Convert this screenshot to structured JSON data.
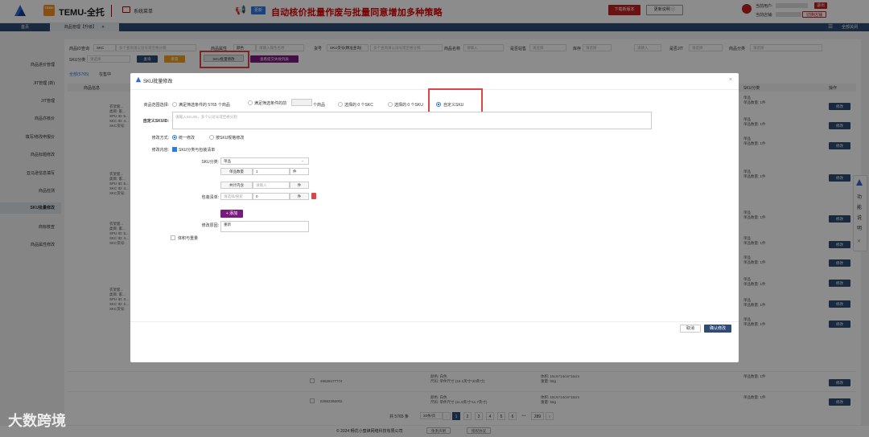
{
  "header": {
    "temu_badge": "TEMU",
    "brand": "TEMU-全托",
    "system_menu": "系统菜单",
    "new_tag": "更新",
    "banner": "自动核价批量作废与批量同意增加多种策略",
    "download_button": "下载新版本",
    "update_button": "更新说明 ⓘ",
    "user_label": "当前用户:",
    "logout": "退出",
    "shop_label": "当前店铺:",
    "switch_shop": "切换店铺"
  },
  "tabs": {
    "home": "首页",
    "product": "商品管理【升级】",
    "close_all": "全部关闭"
  },
  "sidebar": {
    "items": [
      {
        "label": "商品进价管理"
      },
      {
        "label": "JIT管理 (新)"
      },
      {
        "label": "JIT管理"
      },
      {
        "label": "商品亦核价"
      },
      {
        "label": "填写/修改申报价"
      },
      {
        "label": "商品标题修改"
      },
      {
        "label": "亚马逊信息填写"
      },
      {
        "label": "商品检测"
      },
      {
        "label": "SKU批量修改"
      },
      {
        "label": "商标核查"
      },
      {
        "label": "商品属性修改"
      }
    ]
  },
  "filters": {
    "product_id_label": "商品ID查询",
    "product_id_mode": "SKC",
    "product_id_placeholder": "多个查询请以逗号或空格分隔",
    "attr_label": "商品属性",
    "attr_mode": "颜色",
    "attr_placeholder": "请输入属性名称",
    "cargo_label": "货号",
    "cargo_mode": "SKU货号(精准查询)",
    "cargo_placeholder": "多个查询请以逗号或空格分隔",
    "name_label": "商品名称",
    "name_placeholder": "请输入",
    "site_label": "是否站售",
    "site_value": "请选择",
    "stock_label": "库存",
    "stock_value": "请选择",
    "stock_input": "请输入",
    "jit_label": "是否JIT",
    "jit_value": "请选择",
    "category_label": "商品分类",
    "category_value": "请选择",
    "sku_class_label": "SKU分类",
    "sku_class_value": "请选择",
    "query_button": "查询",
    "reset_button": "重置",
    "sku_batch_button": "SKU批量修改",
    "view_failed_button": "查看提交失败列表"
  },
  "list": {
    "tab_all": "全部(5765)",
    "tab_other": "在售中",
    "col_info": "商品信息",
    "col_sku": "SKU分类",
    "col_action": "操作",
    "rows": [
      {
        "info": [
          "衣架套...",
          "类目: 家...",
          "SPU ID: 5...",
          "SKC ID: 4...",
          "SKC货号:"
        ],
        "sku": [
          "单品",
          "单品数量: 1件"
        ],
        "action": "修改"
      },
      {
        "info": [],
        "sku": [
          "单品",
          "单品数量: 1件"
        ],
        "action": "修改"
      },
      {
        "info": [],
        "sku": [
          "单品",
          "单品数量: 1件"
        ],
        "action": "修改"
      },
      {
        "info": [
          "衣架套...",
          "类目: 家...",
          "SPU ID: 5...",
          "SKC ID: 4...",
          "SKC货号:"
        ],
        "sku": [
          "单品",
          "单品数量: 1件"
        ],
        "action": "修改"
      },
      {
        "info": [],
        "sku": [
          "单品",
          "单品数量: 1件"
        ],
        "action": "修改"
      },
      {
        "info": [],
        "sku": [
          "单品",
          "单品数量: 1件"
        ],
        "action": "修改"
      },
      {
        "info": [
          "衣架套...",
          "类目: 家...",
          "SPU ID: 5...",
          "SKC ID: 4...",
          "SKC货号:"
        ],
        "sku": [
          "单品",
          "单品数量: 1件"
        ],
        "action": "修改"
      },
      {
        "info": [],
        "sku": [
          "单品",
          "单品数量: 1件"
        ],
        "action": "修改"
      },
      {
        "info": [
          "衣架套...",
          "类目: 家...",
          "SPU ID: 3...",
          "SKC ID: 2...",
          "SKC货号:"
        ],
        "sku": [
          "单品",
          "单品数量: 1件"
        ],
        "action": "修改"
      },
      {
        "info": [],
        "sku": [
          "单品",
          "单品数量: 1件"
        ],
        "action": "修改"
      }
    ],
    "bottom_rows": [
      {
        "id": "49628477774",
        "spec": [
          "颜色: 白色",
          "尺码: 单件尺寸 (16 1英寸*20英寸)"
        ],
        "volume": [
          "体积: 15cm*14cm*15cm",
          "重量: 55g"
        ],
        "qty": "单品数量: 1件",
        "action": "修改"
      },
      {
        "id": "52862266002",
        "spec": [
          "颜色: 白色",
          "尺码: 单件尺寸 (11.8英寸*11.7英寸)"
        ],
        "volume": [
          "体积: 15cm*14cm*15cm",
          "重量: 55g"
        ],
        "qty": "单品数量: 1件",
        "action": "修改"
      }
    ]
  },
  "modal": {
    "title": "SKU批量修改",
    "scope_label": "商品范围选择:",
    "scope_options": [
      {
        "label": "满足筛选条件的 5765 个商品",
        "selected": false
      },
      {
        "label": "满足筛选条件的前",
        "selected": false
      },
      {
        "label": "个商品",
        "selected": false
      },
      {
        "label": "选择的 0 个SKC",
        "selected": false
      },
      {
        "label": "选择的 0 个SKU",
        "selected": false
      },
      {
        "label": "自定义SKU",
        "selected": true
      }
    ],
    "custom_label": "自定义SKUID:",
    "custom_placeholder": "请输入SKUID，多个以逗号或空格分割",
    "mode_label": "修改方式:",
    "mode_unified": "统一修改",
    "mode_by_sku": "按SKU规格修改",
    "content_label": "修改内容:",
    "content_check": "SKU分类与包装清单",
    "sku_class_label": "SKU分类:",
    "sku_class_value": "单品",
    "single_qty_label": "单品数量",
    "single_qty_value": "1",
    "single_unit": "件",
    "inner_label": "共计内含",
    "inner_placeholder": "请输入",
    "inner_unit": "件",
    "pack_label": "包装清单:",
    "pack_placeholder": "请选择/搜索",
    "pack_value": "0",
    "pack_unit": "件",
    "add_button": "+ 添加",
    "reason_label": "修改原因:",
    "reason_value": "重新",
    "volume_label": "体积与重量",
    "cancel_button": "取消",
    "confirm_button": "确认修改"
  },
  "pagination": {
    "total": "共 5765 条",
    "per_page": "20条/页",
    "pages": [
      "1",
      "2",
      "3",
      "4",
      "5",
      "6",
      "289"
    ],
    "ellipsis": "•••",
    "current": "1"
  },
  "footer": {
    "copyright": "© 2024 畅优小蜜蜂网络科技有限公司",
    "disclaimer": "免责声明",
    "privacy": "授权协议"
  },
  "help": {
    "label": [
      "功",
      "能",
      "说",
      "明"
    ]
  },
  "watermark": "大数跨境",
  "colors": {
    "primary": "#2e4b74",
    "accent_red": "#c21f1f",
    "purple": "#7b1a7e",
    "highlight_box": "#e04545"
  }
}
